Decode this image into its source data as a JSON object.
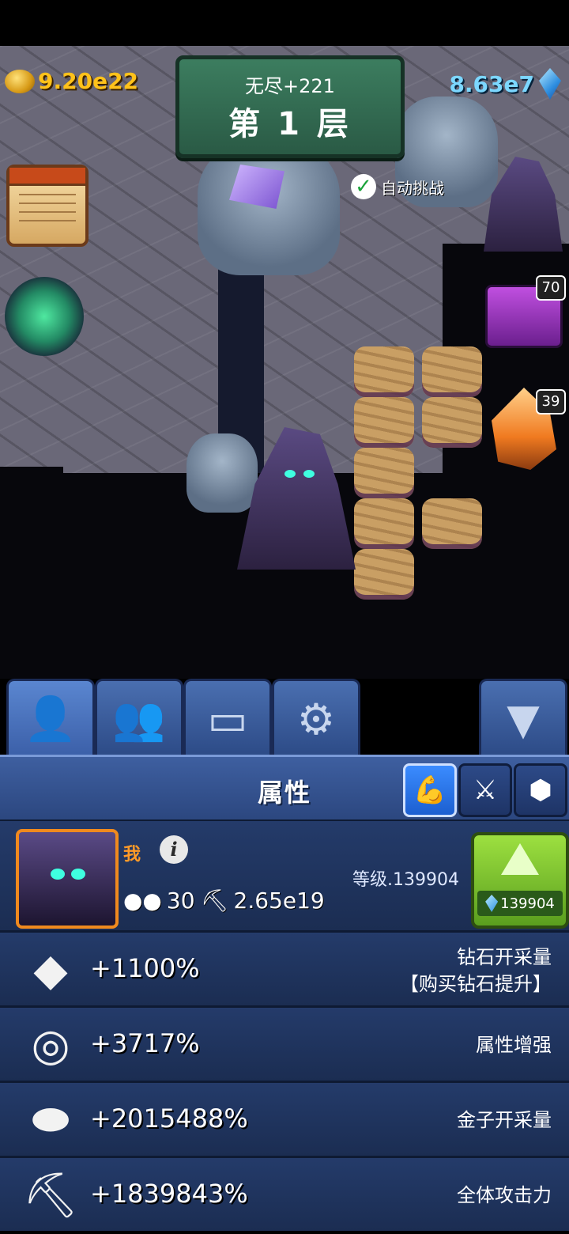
{
  "hud": {
    "gold_value": "9.20e22",
    "diamond_value": "8.63e7",
    "mode_label": "无尽+221",
    "floor_label": "第 1 层",
    "auto_challenge": "自动挑战",
    "chest_count": "70",
    "ore_count": "39"
  },
  "tabs": [
    {
      "icon": "person-pickaxe-icon"
    },
    {
      "icon": "group-icon"
    },
    {
      "icon": "chest-icon"
    },
    {
      "icon": "gear-icon"
    },
    {
      "icon": "collapse-down-icon"
    }
  ],
  "panel": {
    "title": "属性",
    "subtabs": [
      {
        "icon": "strength-icon",
        "active": true
      },
      {
        "icon": "swords-icon",
        "active": false
      },
      {
        "icon": "rocks-icon",
        "active": false
      }
    ]
  },
  "profile": {
    "name": "我",
    "info_glyph": "i",
    "workers": "30",
    "power": "2.65e19",
    "level_label": "等级.139904",
    "upgrade_cost": "139904"
  },
  "stats": [
    {
      "icon": "diamond-icon",
      "value": "+1100%",
      "label_line1": "钻石开采量",
      "label_line2": "【购买钻石提升】"
    },
    {
      "icon": "target-ring-icon",
      "value": "+3717%",
      "label_line1": "属性增强"
    },
    {
      "icon": "gold-nugget-icon",
      "value": "+2015488%",
      "label_line1": "金子开采量"
    },
    {
      "icon": "pickaxe-icon",
      "value": "+1839843%",
      "label_line1": "全体攻击力"
    }
  ]
}
